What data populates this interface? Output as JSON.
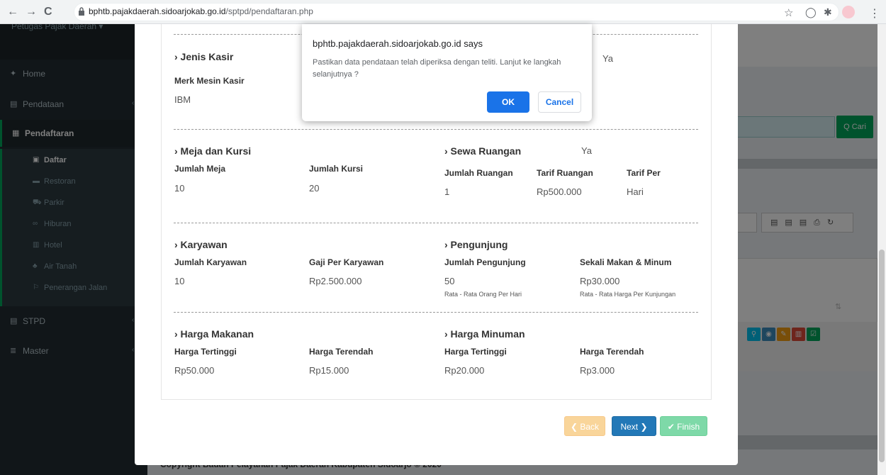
{
  "browser": {
    "back": "←",
    "forward": "→",
    "reload": "C",
    "url_host": "bphtb.pajakdaerah.sidoarjokab.go.id",
    "url_path": "/sptpd/pendaftaran.php",
    "star": "☆",
    "menu": "⋮"
  },
  "sidebar": {
    "user": "Petugas Pajak Daerah ▾",
    "items": [
      {
        "icon": "✦",
        "label": "Home"
      },
      {
        "icon": "▤",
        "label": "Pendataan",
        "chevron": "‹"
      },
      {
        "icon": "▦",
        "label": "Pendaftaran",
        "chevron": "⌄"
      },
      {
        "icon": "▤",
        "label": "STPD",
        "chevron": "‹"
      },
      {
        "icon": "≣",
        "label": "Master",
        "chevron": "‹"
      }
    ],
    "sub": [
      {
        "icon": "▣",
        "label": "Daftar"
      },
      {
        "icon": "▬",
        "label": "Restoran"
      },
      {
        "icon": "⛟",
        "label": "Parkir"
      },
      {
        "icon": "∞",
        "label": "Hiburan"
      },
      {
        "icon": "▥",
        "label": "Hotel"
      },
      {
        "icon": "♣",
        "label": "Air Tanah"
      },
      {
        "icon": "⚐",
        "label": "Penerangan Jalan"
      }
    ]
  },
  "background": {
    "ya_top": "Ya",
    "search_btn": "Q Cari",
    "sort_icon": "⇅"
  },
  "dialog": {
    "title": "bphtb.pajakdaerah.sidoarjokab.go.id says",
    "message": "Pastikan data pendataan telah diperiksa dengan teliti. Lanjut ke langkah selanjutnya ?",
    "ok": "OK",
    "cancel": "Cancel"
  },
  "form": {
    "jenis_kasir": {
      "title": "› Jenis Kasir",
      "merk_label": "Merk Mesin Kasir",
      "merk_value": "IBM",
      "ya": "Ya"
    },
    "meja_kursi": {
      "title": "› Meja dan Kursi",
      "meja_label": "Jumlah Meja",
      "meja_value": "10",
      "kursi_label": "Jumlah Kursi",
      "kursi_value": "20"
    },
    "sewa_ruangan": {
      "title": "› Sewa Ruangan",
      "ya": "Ya",
      "jumlah_label": "Jumlah Ruangan",
      "jumlah_value": "1",
      "tarif_label": "Tarif Ruangan",
      "tarif_value": "Rp500.000",
      "per_label": "Tarif Per",
      "per_value": "Hari"
    },
    "karyawan": {
      "title": "› Karyawan",
      "jumlah_label": "Jumlah Karyawan",
      "jumlah_value": "10",
      "gaji_label": "Gaji Per Karyawan",
      "gaji_value": "Rp2.500.000"
    },
    "pengunjung": {
      "title": "› Pengunjung",
      "jumlah_label": "Jumlah Pengunjung",
      "jumlah_value": "50",
      "jumlah_note": "Rata - Rata Orang Per Hari",
      "sekali_label": "Sekali Makan & Minum",
      "sekali_value": "Rp30.000",
      "sekali_note": "Rata - Rata Harga Per Kunjungan"
    },
    "harga_makanan": {
      "title": "› Harga Makanan",
      "tinggi_label": "Harga Tertinggi",
      "tinggi_value": "Rp50.000",
      "rendah_label": "Harga Terendah",
      "rendah_value": "Rp15.000"
    },
    "harga_minuman": {
      "title": "› Harga Minuman",
      "tinggi_label": "Harga Tertinggi",
      "tinggi_value": "Rp20.000",
      "rendah_label": "Harga Terendah",
      "rendah_value": "Rp3.000"
    }
  },
  "buttons": {
    "back": "❮ Back",
    "next": "Next ❯",
    "finish": "✔ Finish"
  },
  "footer": {
    "copyright": "Copyright Badan Pelayanan Pajak Daerah Kabupaten Sidoarjo © 2020"
  }
}
